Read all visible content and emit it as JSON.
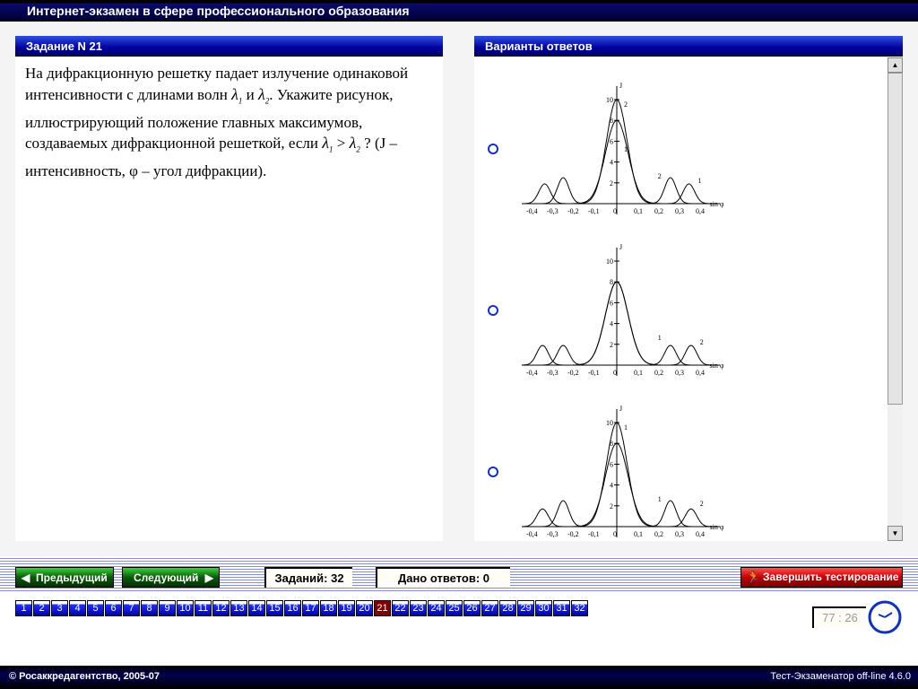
{
  "window_title": "Интернет-экзамен в сфере профессионального образования",
  "task": {
    "header": "Задание N 21",
    "text_parts": [
      "На дифракционную решетку падает излучение одинаковой интенсивности с длинами волн ",
      "λ",
      "1",
      " и ",
      "λ",
      "2",
      ". Укажите рисунок, иллюстрирующий положение главных максимумов, создаваемых дифракционной решеткой, если ",
      "λ",
      "1",
      " > ",
      "λ",
      "2",
      " ? (J – интенсивность, φ – угол дифракции)."
    ]
  },
  "answers": {
    "header": "Варианты ответов",
    "options": [
      {
        "chart_data": {
          "type": "line",
          "ylabel": "J",
          "xlabel": "sin φ",
          "xlim": [
            -0.45,
            0.45
          ],
          "ylim": [
            0,
            10
          ],
          "xticks": [
            "-0,4",
            "-0,3",
            "-0,2",
            "-0,1",
            "0",
            "0,1",
            "0,2",
            "0,3",
            "0,4"
          ],
          "yticks": [
            "2",
            "4",
            "6",
            "8",
            "10"
          ],
          "series": [
            {
              "name": "1",
              "center_peak": 8,
              "side_pos": 0.35,
              "side_peak": 1.9
            },
            {
              "name": "2",
              "center_peak": 10,
              "side_pos": 0.26,
              "side_peak": 2.5
            }
          ],
          "labels": [
            "2",
            "1",
            "2",
            "1"
          ]
        }
      },
      {
        "chart_data": {
          "type": "line",
          "ylabel": "J",
          "xlabel": "sin φ",
          "xlim": [
            -0.45,
            0.45
          ],
          "ylim": [
            0,
            10
          ],
          "xticks": [
            "-0,4",
            "-0,3",
            "-0,2",
            "-0,1",
            "0",
            "0,1",
            "0,2",
            "0,3",
            "0,4"
          ],
          "yticks": [
            "2",
            "4",
            "6",
            "8",
            "10"
          ],
          "series": [
            {
              "name": "1",
              "center_peak": 8,
              "side_pos": 0.26,
              "side_peak": 1.9
            },
            {
              "name": "2",
              "center_peak": 8,
              "side_pos": 0.36,
              "side_peak": 1.9
            }
          ],
          "labels": [
            "",
            "",
            "1",
            "2"
          ]
        }
      },
      {
        "chart_data": {
          "type": "line",
          "ylabel": "J",
          "xlabel": "sin φ",
          "xlim": [
            -0.45,
            0.45
          ],
          "ylim": [
            0,
            10
          ],
          "xticks": [
            "-0,4",
            "-0,3",
            "-0,2",
            "-0,1",
            "0",
            "0,1",
            "0,2",
            "0,3",
            "0,4"
          ],
          "yticks": [
            "2",
            "4",
            "6",
            "8",
            "10"
          ],
          "series": [
            {
              "name": "1",
              "center_peak": 10,
              "side_pos": 0.26,
              "side_peak": 2.5
            },
            {
              "name": "2",
              "center_peak": 8,
              "side_pos": 0.36,
              "side_peak": 1.7
            }
          ],
          "labels": [
            "1",
            "",
            "1",
            "2"
          ]
        }
      }
    ]
  },
  "nav": {
    "prev": "Предыдущий",
    "next": "Следующий",
    "tasks_count": "Заданий: 32",
    "answered": "Дано ответов: 0",
    "finish": "Завершить тестирование"
  },
  "pages": [
    "1",
    "2",
    "3",
    "4",
    "5",
    "6",
    "7",
    "8",
    "9",
    "10",
    "11",
    "12",
    "13",
    "14",
    "15",
    "16",
    "17",
    "18",
    "19",
    "20",
    "21",
    "22",
    "23",
    "24",
    "25",
    "26",
    "27",
    "28",
    "29",
    "30",
    "31",
    "32"
  ],
  "current_page": "21",
  "timer": "77 : 26",
  "footer": {
    "copyright": "© Росаккредагентство, 2005-07",
    "version": "Тест-Экзаменатор off-line 4.6.0"
  },
  "colors": {
    "header_blue": "#0000a0",
    "current_page": "#800000",
    "finish_red": "#c00000",
    "nav_green": "#0a5a0a"
  }
}
